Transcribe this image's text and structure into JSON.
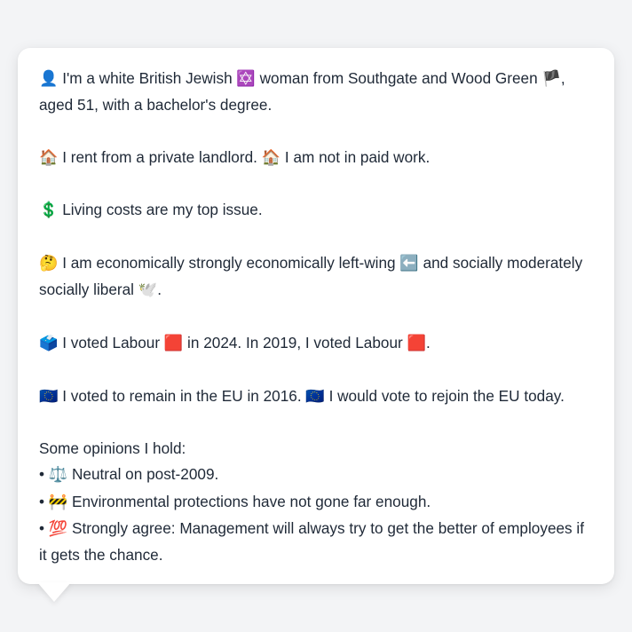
{
  "profile": {
    "identity": {
      "emoji": "👤",
      "text_a": "I'm a white British Jewish",
      "religion_emoji": "✡️",
      "text_b": "woman from Southgate and Wood Green",
      "flag_emoji": "🏴",
      "text_c": ", aged 51, with a bachelor's degree."
    },
    "housing": {
      "emoji1": "🏠",
      "text1": "I rent from a private landlord.",
      "emoji2": "🏠",
      "text2": "I am not in paid work."
    },
    "issue": {
      "emoji": "💲",
      "text": "Living costs are my top issue."
    },
    "ideology": {
      "emoji": "🤔",
      "text_a": "I am economically strongly economically left-wing",
      "left_emoji": "⬅️",
      "text_b": "and socially moderately socially liberal",
      "dove_emoji": "🕊️",
      "text_c": "."
    },
    "votes": {
      "emoji": "🗳️",
      "text_a": "I voted Labour",
      "red1": "🟥",
      "text_b": "in 2024. In 2019, I voted Labour",
      "red2": "🟥",
      "text_c": "."
    },
    "eu": {
      "emoji1": "🇪🇺",
      "text1": "I voted to remain in the EU in 2016.",
      "emoji2": "🇪🇺",
      "text2": "I would vote to rejoin the EU today."
    },
    "opinions": {
      "heading": "Some opinions I hold:",
      "bullet": "•",
      "items": [
        {
          "emoji": "⚖️",
          "text": "Neutral on post-2009."
        },
        {
          "emoji": "🚧",
          "text": "Environmental protections have not gone far enough."
        },
        {
          "emoji": "💯",
          "text": "Strongly agree: Management will always try to get the better of employees if it gets the chance."
        }
      ]
    }
  }
}
